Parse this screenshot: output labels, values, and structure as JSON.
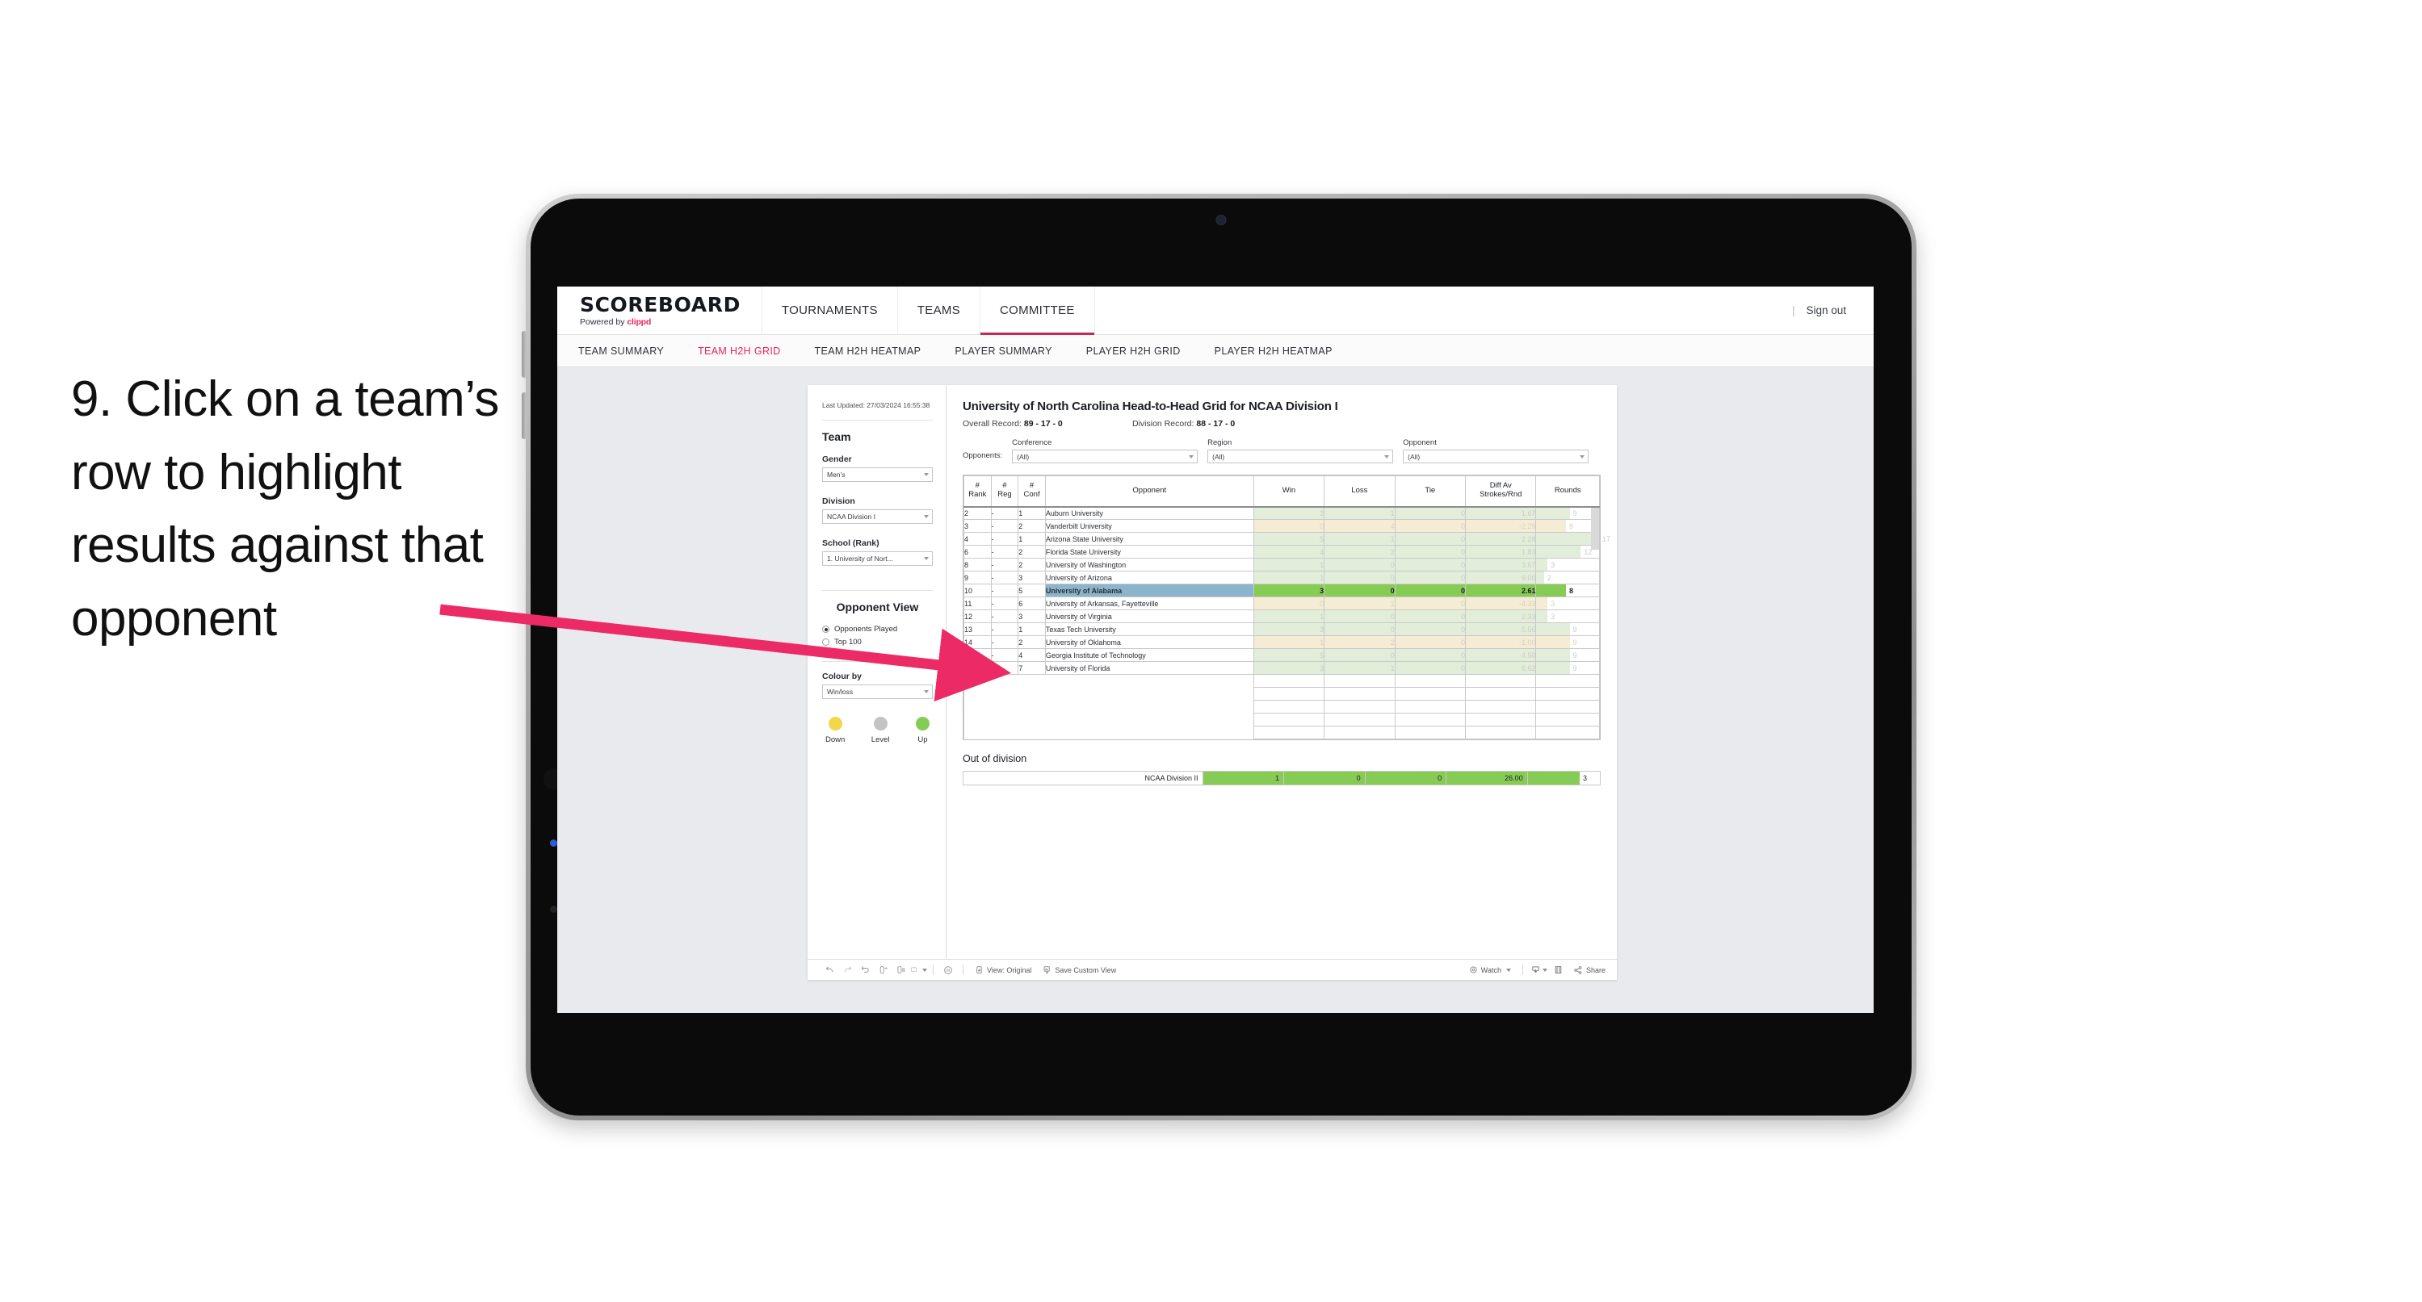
{
  "caption": "9. Click on a team’s row to highlight results against that opponent",
  "topnav": {
    "brand_title": "SCOREBOARD",
    "brand_sub_prefix": "Powered by ",
    "brand_sub_name": "clippd",
    "items": [
      {
        "label": "TOURNAMENTS",
        "active": false
      },
      {
        "label": "TEAMS",
        "active": false
      },
      {
        "label": "COMMITTEE",
        "active": true
      }
    ],
    "divider": "|",
    "signout": "Sign out"
  },
  "subnav": {
    "items": [
      {
        "label": "TEAM SUMMARY",
        "active": false
      },
      {
        "label": "TEAM H2H GRID",
        "active": true
      },
      {
        "label": "TEAM H2H HEATMAP",
        "active": false
      },
      {
        "label": "PLAYER SUMMARY",
        "active": false
      },
      {
        "label": "PLAYER H2H GRID",
        "active": false
      },
      {
        "label": "PLAYER H2H HEATMAP",
        "active": false
      }
    ]
  },
  "filters": {
    "last_updated": "Last Updated: 27/03/2024 16:55:38",
    "team_title": "Team",
    "gender_label": "Gender",
    "gender_value": "Men’s",
    "division_label": "Division",
    "division_value": "NCAA Division I",
    "school_label": "School (Rank)",
    "school_value": "1. University of Nort...",
    "opponent_view_title": "Opponent View",
    "opponent_view_options": [
      {
        "label": "Opponents Played",
        "selected": true
      },
      {
        "label": "Top 100",
        "selected": false
      }
    ],
    "colour_by_label": "Colour by",
    "colour_by_value": "Win/loss",
    "legend": [
      {
        "label": "Down",
        "color": "#f2d64b"
      },
      {
        "label": "Level",
        "color": "#c4c4c4"
      },
      {
        "label": "Up",
        "color": "#86cc54"
      }
    ]
  },
  "content": {
    "title": "University of North Carolina Head-to-Head Grid for NCAA Division I",
    "overall_record_label": "Overall Record: ",
    "overall_record_value": "89 - 17 - 0",
    "division_record_label": "Division Record: ",
    "division_record_value": "88 - 17 - 0",
    "opponents_label": "Opponents:",
    "opponent_filters": [
      {
        "label": "Conference",
        "value": "(All)"
      },
      {
        "label": "Region",
        "value": "(All)"
      },
      {
        "label": "Opponent",
        "value": "(All)"
      }
    ]
  },
  "chart_data": {
    "type": "table",
    "title": "University of North Carolina Head-to-Head Grid for NCAA Division I",
    "columns": [
      "# Rank",
      "# Reg",
      "# Conf",
      "Opponent",
      "Win",
      "Loss",
      "Tie",
      "Diff Av Strokes/Rnd",
      "Rounds"
    ],
    "header_lines": {
      "rank": [
        "#",
        "Rank"
      ],
      "reg": [
        "#",
        "Reg"
      ],
      "conf": [
        "#",
        "Conf"
      ],
      "opponent": "Opponent",
      "win": "Win",
      "loss": "Loss",
      "tie": "Tie",
      "diff": [
        "Diff Av",
        "Strokes/Rnd"
      ],
      "rounds": "Rounds"
    },
    "rows": [
      {
        "rank": "2",
        "reg": "-",
        "conf": "1",
        "opponent": "Auburn University",
        "win": "2",
        "loss": "1",
        "tie": "0",
        "diff": "1.67",
        "rounds": "9",
        "result": "win",
        "selected": false
      },
      {
        "rank": "3",
        "reg": "-",
        "conf": "2",
        "opponent": "Vanderbilt University",
        "win": "0",
        "loss": "4",
        "tie": "0",
        "diff": "-2.29",
        "rounds": "8",
        "result": "loss",
        "selected": false
      },
      {
        "rank": "4",
        "reg": "-",
        "conf": "1",
        "opponent": "Arizona State University",
        "win": "5",
        "loss": "1",
        "tie": "0",
        "diff": "2.28",
        "rounds": "17",
        "result": "win",
        "selected": false
      },
      {
        "rank": "6",
        "reg": "-",
        "conf": "2",
        "opponent": "Florida State University",
        "win": "4",
        "loss": "2",
        "tie": "0",
        "diff": "1.83",
        "rounds": "12",
        "result": "win",
        "selected": false
      },
      {
        "rank": "8",
        "reg": "-",
        "conf": "2",
        "opponent": "University of Washington",
        "win": "1",
        "loss": "0",
        "tie": "0",
        "diff": "3.67",
        "rounds": "3",
        "result": "win",
        "selected": false
      },
      {
        "rank": "9",
        "reg": "-",
        "conf": "3",
        "opponent": "University of Arizona",
        "win": "1",
        "loss": "0",
        "tie": "0",
        "diff": "9.00",
        "rounds": "2",
        "result": "win",
        "selected": false
      },
      {
        "rank": "10",
        "reg": "-",
        "conf": "5",
        "opponent": "University of Alabama",
        "win": "3",
        "loss": "0",
        "tie": "0",
        "diff": "2.61",
        "rounds": "8",
        "result": "win",
        "selected": true
      },
      {
        "rank": "11",
        "reg": "-",
        "conf": "6",
        "opponent": "University of Arkansas, Fayetteville",
        "win": "0",
        "loss": "1",
        "tie": "0",
        "diff": "-4.33",
        "rounds": "3",
        "result": "loss",
        "selected": false
      },
      {
        "rank": "12",
        "reg": "-",
        "conf": "3",
        "opponent": "University of Virginia",
        "win": "1",
        "loss": "0",
        "tie": "0",
        "diff": "2.33",
        "rounds": "3",
        "result": "win",
        "selected": false
      },
      {
        "rank": "13",
        "reg": "-",
        "conf": "1",
        "opponent": "Texas Tech University",
        "win": "3",
        "loss": "0",
        "tie": "0",
        "diff": "5.56",
        "rounds": "9",
        "result": "win",
        "selected": false
      },
      {
        "rank": "14",
        "reg": "-",
        "conf": "2",
        "opponent": "University of Oklahoma",
        "win": "1",
        "loss": "2",
        "tie": "0",
        "diff": "-1.00",
        "rounds": "9",
        "result": "loss",
        "selected": false
      },
      {
        "rank": "15",
        "reg": "-",
        "conf": "4",
        "opponent": "Georgia Institute of Technology",
        "win": "5",
        "loss": "0",
        "tie": "0",
        "diff": "4.50",
        "rounds": "9",
        "result": "win",
        "selected": false
      },
      {
        "rank": "16",
        "reg": "-",
        "conf": "7",
        "opponent": "University of Florida",
        "win": "3",
        "loss": "1",
        "tie": "0",
        "diff": "6.62",
        "rounds": "9",
        "result": "win",
        "selected": false
      }
    ],
    "out_of_division": {
      "title": "Out of division",
      "rows": [
        {
          "label": "NCAA Division II",
          "win": "1",
          "loss": "0",
          "tie": "0",
          "diff": "26.00",
          "rounds": "3"
        }
      ]
    },
    "colors": {
      "win_fill": "#86cc54",
      "win_dim": "#e2eed9",
      "loss_dim": "#f5ecd5",
      "selected_row": "#8cb4cc"
    }
  },
  "toolbar": {
    "icons": [
      "undo-icon",
      "redo-icon",
      "revert-icon",
      "refresh-icon",
      "pause-icon",
      "presentation-icon"
    ],
    "view_label": "View: Original",
    "save_label": "Save Custom View",
    "watch_label": "Watch",
    "share_label": "Share"
  }
}
